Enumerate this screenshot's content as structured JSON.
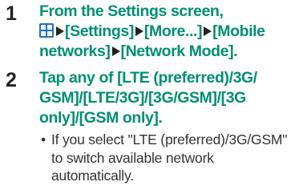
{
  "steps": [
    {
      "number": "1",
      "lines": [
        "From the Settings screen,",
        "[Settings]",
        "[More...]",
        "[Mobile",
        "networks]",
        "[Network Mode]."
      ]
    },
    {
      "number": "2",
      "lines": [
        "Tap any of [LTE (preferred)/3G/",
        "GSM]/[LTE/3G]/[3G/GSM]/[3G",
        "only]/[GSM only]."
      ],
      "note": {
        "bullet": "•",
        "lines": [
          "If you select \"LTE (preferred)/3G/GSM\"",
          "to switch available network",
          "automatically."
        ]
      }
    }
  ],
  "icons": {
    "apps": "apps-grid-icon",
    "arrow": "right-triangle-arrow-icon"
  },
  "colors": {
    "step_text": "#008f72",
    "number": "#222222",
    "apps_icon": "#1a73c6"
  }
}
